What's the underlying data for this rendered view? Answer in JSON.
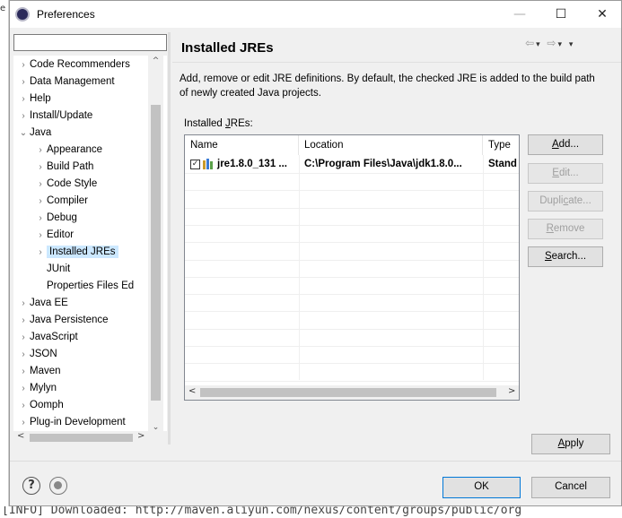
{
  "window": {
    "title": "Preferences",
    "minimize": "—",
    "maximize": "☐",
    "close": "✕"
  },
  "background": {
    "bottom_text": "[INFO] Downloaded: http://maven.aliyun.com/nexus/content/groups/public/org"
  },
  "sidebar": {
    "filter_value": "",
    "items": [
      {
        "label": "Code Recommenders",
        "arrow": "›",
        "indent": 0
      },
      {
        "label": "Data Management",
        "arrow": "›",
        "indent": 0
      },
      {
        "label": "Help",
        "arrow": "›",
        "indent": 0
      },
      {
        "label": "Install/Update",
        "arrow": "›",
        "indent": 0
      },
      {
        "label": "Java",
        "arrow": "⌄",
        "indent": 0
      },
      {
        "label": "Appearance",
        "arrow": "›",
        "indent": 1
      },
      {
        "label": "Build Path",
        "arrow": "›",
        "indent": 1
      },
      {
        "label": "Code Style",
        "arrow": "›",
        "indent": 1
      },
      {
        "label": "Compiler",
        "arrow": "›",
        "indent": 1
      },
      {
        "label": "Debug",
        "arrow": "›",
        "indent": 1
      },
      {
        "label": "Editor",
        "arrow": "›",
        "indent": 1
      },
      {
        "label": "Installed JREs",
        "arrow": "›",
        "indent": 1,
        "selected": true
      },
      {
        "label": "JUnit",
        "arrow": "",
        "indent": 1
      },
      {
        "label": "Properties Files Ed",
        "arrow": "",
        "indent": 1
      },
      {
        "label": "Java EE",
        "arrow": "›",
        "indent": 0
      },
      {
        "label": "Java Persistence",
        "arrow": "›",
        "indent": 0
      },
      {
        "label": "JavaScript",
        "arrow": "›",
        "indent": 0
      },
      {
        "label": "JSON",
        "arrow": "›",
        "indent": 0
      },
      {
        "label": "Maven",
        "arrow": "›",
        "indent": 0
      },
      {
        "label": "Mylyn",
        "arrow": "›",
        "indent": 0
      },
      {
        "label": "Oomph",
        "arrow": "›",
        "indent": 0
      },
      {
        "label": "Plug-in Development",
        "arrow": "›",
        "indent": 0
      }
    ]
  },
  "main": {
    "title": "Installed JREs",
    "description": "Add, remove or edit JRE definitions. By default, the checked JRE is added to the build path of newly created Java projects.",
    "table_label_pre": "Installed ",
    "table_label_u": "J",
    "table_label_post": "REs:",
    "columns": [
      "Name",
      "Location",
      "Type"
    ],
    "rows": [
      {
        "checked": true,
        "name": "jre1.8.0_131 ...",
        "location": "C:\\Program Files\\Java\\jdk1.8.0...",
        "type": "Stand"
      }
    ],
    "buttons": {
      "add": {
        "u": "A",
        "rest": "dd..."
      },
      "edit": {
        "u": "E",
        "rest": "dit..."
      },
      "duplicate": {
        "pre": "Dupli",
        "u": "c",
        "post": "ate..."
      },
      "remove": {
        "u": "R",
        "rest": "emove"
      },
      "search": {
        "u": "S",
        "rest": "earch..."
      },
      "apply": {
        "u": "A",
        "rest": "pply"
      }
    }
  },
  "footer": {
    "help_icon": "?",
    "ok_label": "OK",
    "cancel_label": "Cancel"
  }
}
